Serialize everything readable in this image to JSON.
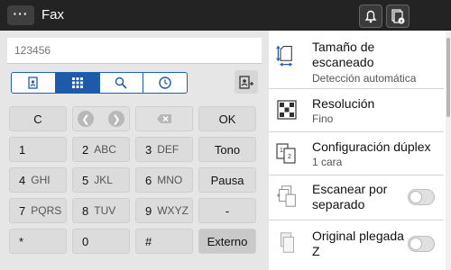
{
  "header": {
    "title": "Fax",
    "menu_label": "···"
  },
  "destination": {
    "value": "",
    "placeholder": "123456"
  },
  "keypad": {
    "row1": {
      "clear": "C",
      "ok": "OK"
    },
    "keys": [
      {
        "main": "1",
        "sub": ""
      },
      {
        "main": "2",
        "sub": "ABC"
      },
      {
        "main": "3",
        "sub": "DEF"
      },
      {
        "main": "4",
        "sub": "GHI"
      },
      {
        "main": "5",
        "sub": "JKL"
      },
      {
        "main": "6",
        "sub": "MNO"
      },
      {
        "main": "7",
        "sub": "PQRS"
      },
      {
        "main": "8",
        "sub": "TUV"
      },
      {
        "main": "9",
        "sub": "WXYZ"
      },
      {
        "main": "*",
        "sub": ""
      },
      {
        "main": "0",
        "sub": ""
      },
      {
        "main": "#",
        "sub": ""
      }
    ],
    "side": [
      "Tono",
      "Pausa",
      "-",
      "Externo"
    ]
  },
  "settings": [
    {
      "title": "Tamaño de escaneado",
      "value": "Detección automática",
      "icon": "scan-size-icon"
    },
    {
      "title": "Resolución",
      "value": "Fino",
      "icon": "resolution-icon"
    },
    {
      "title": "Configuración dúplex",
      "value": "1 cara",
      "icon": "duplex-icon"
    },
    {
      "title": "Escanear por separado",
      "value": "",
      "icon": "separate-scan-icon",
      "toggle": "off"
    },
    {
      "title": "Original plegada Z",
      "value": "",
      "icon": "z-fold-icon",
      "toggle": "off"
    }
  ],
  "colors": {
    "accent": "#1e5aa8",
    "topbar": "#232323"
  }
}
